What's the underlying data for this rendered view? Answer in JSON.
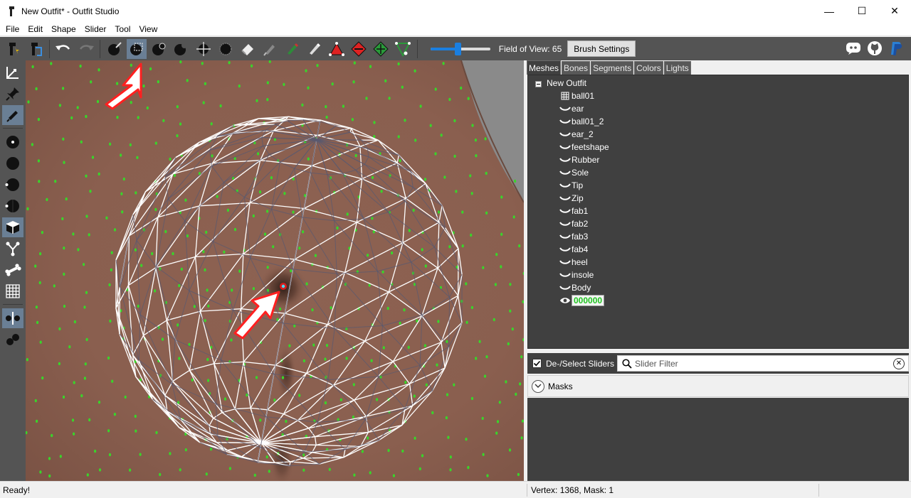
{
  "window": {
    "title": "New Outfit* - Outfit Studio",
    "minimize": "—",
    "maximize": "☐",
    "close": "✕"
  },
  "menu": [
    "File",
    "Edit",
    "Shape",
    "Slider",
    "Tool",
    "View"
  ],
  "toolbar": {
    "icons": [
      "outfit-studio-icon",
      "reference-icon",
      "undo-icon",
      "redo-icon",
      "select-brush-icon",
      "mask-brush-icon",
      "inflate-brush-icon",
      "deflate-brush-icon",
      "move-brush-icon",
      "smooth-brush-icon",
      "undiff-brush-icon",
      "weight-brush-icon",
      "color-brush-icon",
      "alpha-brush-icon",
      "collapse-vertex-icon",
      "flip-edge-icon",
      "split-edge-icon",
      "move-vertex-icon"
    ],
    "field_of_view_label": "Field of View: 65",
    "field_of_view_value": 65,
    "brush_settings_label": "Brush Settings"
  },
  "left_tools": [
    "anchor-tool-icon",
    "pin-tool-icon",
    "brush-tool-icon",
    "vertex-dot-icon",
    "solid-icon",
    "half-icon",
    "split-icon",
    "cube-icon",
    "bone-node-icon",
    "bone-icon",
    "grid-icon",
    "mirror-icon",
    "clone-icon"
  ],
  "right_panel": {
    "tabs": [
      "Meshes",
      "Bones",
      "Segments",
      "Colors",
      "Lights"
    ],
    "active_tab": "Meshes",
    "tree_root": "New Outfit",
    "meshes": [
      "ball01",
      "ear",
      "ball01_2",
      "ear_2",
      "feetshape",
      "Rubber",
      "Sole",
      "Tip",
      "Zip",
      "fab1",
      "fab2",
      "fab3",
      "fab4",
      "heel",
      "insole",
      "Body",
      "000000"
    ],
    "selected_mesh": "000000",
    "deselect_sliders_label": "De-/Select Sliders",
    "slider_filter_placeholder": "Slider Filter",
    "masks_label": "Masks"
  },
  "status": {
    "left": "Ready!",
    "right": "Vertex: 1368, Mask: 1"
  },
  "colors": {
    "accent": "#1a7fe0",
    "selected_text": "#1fc31f",
    "panel_dark": "#404040",
    "toolbar": "#545454",
    "annotation_arrow": "#ff2020"
  }
}
